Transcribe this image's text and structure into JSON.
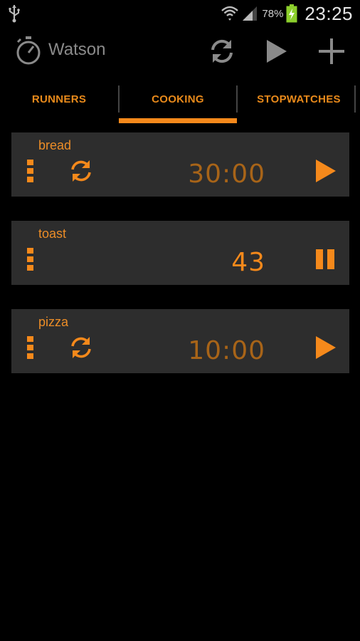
{
  "status_bar": {
    "battery_percent": "78%",
    "time": "23:25"
  },
  "action_bar": {
    "title": "Watson"
  },
  "tabs": [
    {
      "label": "RUNNERS"
    },
    {
      "label": "COOKING"
    },
    {
      "label": "STOPWATCHES"
    }
  ],
  "timers": [
    {
      "name": "bread",
      "time": "30:00"
    },
    {
      "name": "toast",
      "time": "43"
    },
    {
      "name": "pizza",
      "time": "10:00"
    }
  ],
  "colors": {
    "accent": "#f5891b",
    "card_bg": "#2d2d2d",
    "background": "#000000"
  }
}
